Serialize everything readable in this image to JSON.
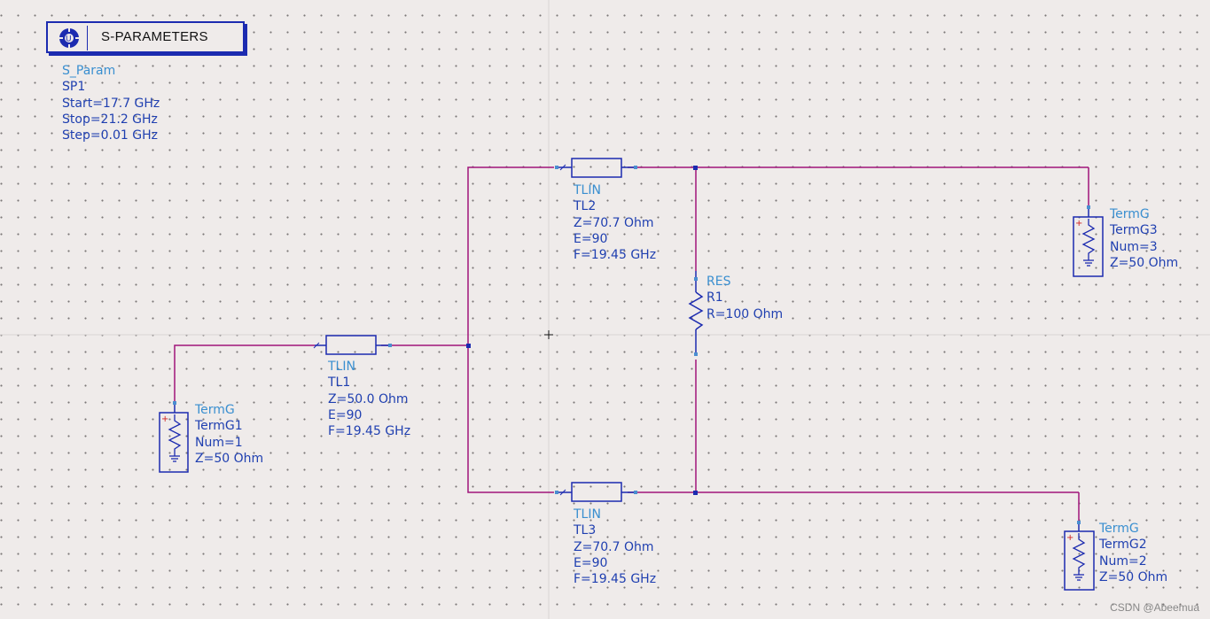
{
  "sparam": {
    "title": "S-PARAMETERS",
    "type": "S_Param",
    "instance": "SP1",
    "params": [
      "Start=17.7 GHz",
      "Stop=21.2 GHz",
      "Step=0.01 GHz"
    ]
  },
  "tl1": {
    "type": "TLIN",
    "instance": "TL1",
    "params": [
      "Z=50.0 Ohm",
      "E=90",
      "F=19.45 GHz"
    ]
  },
  "tl2": {
    "type": "TLIN",
    "instance": "TL2",
    "params": [
      "Z=70.7 Ohm",
      "E=90",
      "F=19.45 GHz"
    ]
  },
  "tl3": {
    "type": "TLIN",
    "instance": "TL3",
    "params": [
      "Z=70.7 Ohm",
      "E=90",
      "F=19.45 GHz"
    ]
  },
  "r1": {
    "type": "RES",
    "instance": "R1",
    "params": [
      "R=100 Ohm"
    ]
  },
  "term1": {
    "type": "TermG",
    "instance": "TermG1",
    "params": [
      "Num=1",
      "Z=50 Ohm"
    ]
  },
  "term2": {
    "type": "TermG",
    "instance": "TermG2",
    "params": [
      "Num=2",
      "Z=50 Ohm"
    ]
  },
  "term3": {
    "type": "TermG",
    "instance": "TermG3",
    "params": [
      "Num=3",
      "Z=50 Ohm"
    ]
  },
  "watermark": "CSDN @Abeemua",
  "colors": {
    "wire": "#a0157a",
    "component": "#1c2bb0",
    "type_label": "#3a8fd0",
    "label": "#1f3fb0",
    "background": "#efebea"
  }
}
